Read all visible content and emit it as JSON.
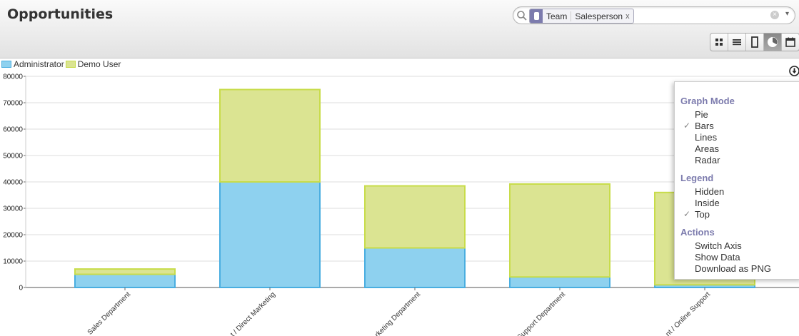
{
  "header": {
    "title": "Opportunities"
  },
  "search": {
    "facet_category": "Team",
    "facet_value": "Salesperson",
    "facet_remove": "x",
    "icon": "search-icon"
  },
  "views": [
    {
      "name": "kanban-view",
      "icon": "grid-icon",
      "active": false
    },
    {
      "name": "list-view",
      "icon": "list-icon",
      "active": false
    },
    {
      "name": "form-view",
      "icon": "form-icon",
      "active": false
    },
    {
      "name": "graph-view",
      "icon": "pie-chart-icon",
      "active": true
    },
    {
      "name": "calendar-view",
      "icon": "calendar-icon",
      "active": false
    }
  ],
  "graph_menu": {
    "sections": [
      {
        "title": "Graph Mode",
        "options": [
          {
            "label": "Pie",
            "checked": false
          },
          {
            "label": "Bars",
            "checked": true
          },
          {
            "label": "Lines",
            "checked": false
          },
          {
            "label": "Areas",
            "checked": false
          },
          {
            "label": "Radar",
            "checked": false
          }
        ]
      },
      {
        "title": "Legend",
        "options": [
          {
            "label": "Hidden",
            "checked": false
          },
          {
            "label": "Inside",
            "checked": false
          },
          {
            "label": "Top",
            "checked": true
          }
        ]
      },
      {
        "title": "Actions",
        "options": [
          {
            "label": "Switch Axis",
            "checked": false
          },
          {
            "label": "Show Data",
            "checked": false
          },
          {
            "label": "Download as PNG",
            "checked": false
          }
        ]
      }
    ]
  },
  "chart_data": {
    "type": "bar",
    "stacked": true,
    "categories": [
      "Sales Department",
      "Direct Marketing",
      "Marketing Department",
      "Support Department",
      "Online Support"
    ],
    "category_labels": [
      "Sales Department",
      "t / Direct Marketing",
      "rketing Department",
      "Support Department",
      "nt / Online Support"
    ],
    "series": [
      {
        "name": "Administrator",
        "values": [
          5000,
          40000,
          15000,
          4000,
          1000
        ],
        "color": "#8ed1ef",
        "stroke": "#4aaee0"
      },
      {
        "name": "Demo User",
        "values": [
          2000,
          35000,
          23500,
          35200,
          35000
        ],
        "color": "#dbe492",
        "stroke": "#c8dc4a"
      }
    ],
    "y_ticks": [
      0,
      10000,
      20000,
      30000,
      40000,
      50000,
      60000,
      70000,
      80000
    ],
    "ylim": [
      0,
      80000
    ],
    "grid": true,
    "legend": "top-left"
  }
}
